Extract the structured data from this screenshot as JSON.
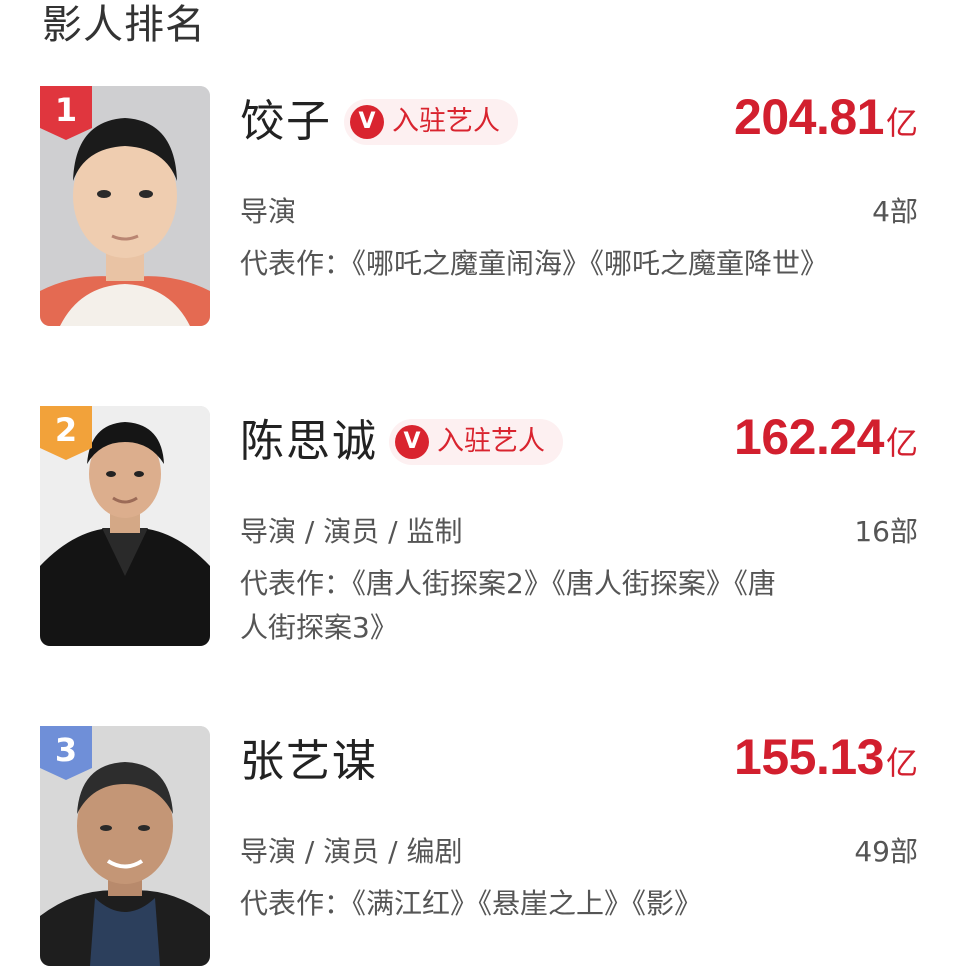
{
  "page": {
    "title": "影人排名"
  },
  "colors": {
    "accent_red": "#d21f2e",
    "tag_bg": "#fdf0f1",
    "rank_1": "#e0363e",
    "rank_2": "#f2a23a",
    "rank_3": "#6f8fd8"
  },
  "ranking": [
    {
      "rank": "1",
      "name": "饺子",
      "verified_tag": {
        "icon": "V",
        "label": "入驻艺人"
      },
      "box_office": {
        "value": "204.81",
        "unit": "亿"
      },
      "roles": "导演",
      "works_count": "4部",
      "representative_works": "代表作：《哪吒之魔童闹海》《哪吒之魔童降世》"
    },
    {
      "rank": "2",
      "name": "陈思诚",
      "verified_tag": {
        "icon": "V",
        "label": "入驻艺人"
      },
      "box_office": {
        "value": "162.24",
        "unit": "亿"
      },
      "roles": "导演 / 演员 / 监制",
      "works_count": "16部",
      "representative_works": "代表作：《唐人街探案2》《唐人街探案》《唐人街探案3》"
    },
    {
      "rank": "3",
      "name": "张艺谋",
      "box_office": {
        "value": "155.13",
        "unit": "亿"
      },
      "roles": "导演 / 演员 / 编剧",
      "works_count": "49部",
      "representative_works": "代表作：《满江红》《悬崖之上》《影》"
    }
  ]
}
